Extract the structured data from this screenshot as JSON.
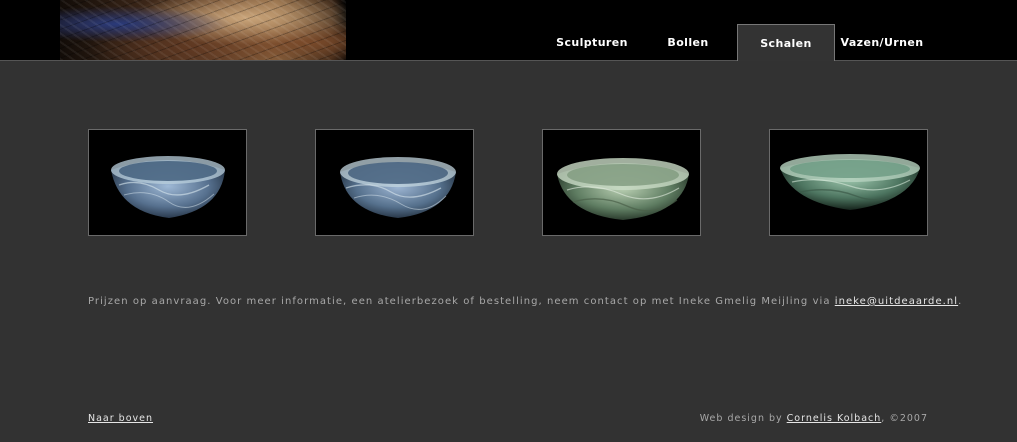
{
  "header": {
    "tabs": [
      {
        "label": "Sculpturen",
        "active": false
      },
      {
        "label": "Bollen",
        "active": false
      },
      {
        "label": "Schalen",
        "active": true
      },
      {
        "label": "Vazen/Urnen",
        "active": false
      }
    ]
  },
  "gallery": {
    "items": [
      {
        "name": "bowl-1",
        "glaze": "#7d9bb8",
        "rim": "#cfe0e8"
      },
      {
        "name": "bowl-2",
        "glaze": "#7d98b5",
        "rim": "#d4e4ea"
      },
      {
        "name": "bowl-3",
        "glaze": "#6f8f74",
        "rim": "#c4d8c4"
      },
      {
        "name": "bowl-4",
        "glaze": "#5f8a72",
        "rim": "#b8d4c0"
      }
    ]
  },
  "info": {
    "text": "Prijzen op aanvraag. Voor meer informatie, een atelierbezoek of bestelling, neem contact op met Ineke Gmelig Meijling via ",
    "email": "ineke@uitdeaarde.nl",
    "end": "."
  },
  "footer": {
    "back_to_top": "Naar boven",
    "credit_prefix": "Web design by ",
    "credit_name": "Cornelis Kolbach",
    "credit_suffix": ", ©2007"
  },
  "colors": {
    "background": "#323232",
    "topbar": "#000000",
    "text": "#a8a8a8",
    "link": "#e6e6e6"
  }
}
